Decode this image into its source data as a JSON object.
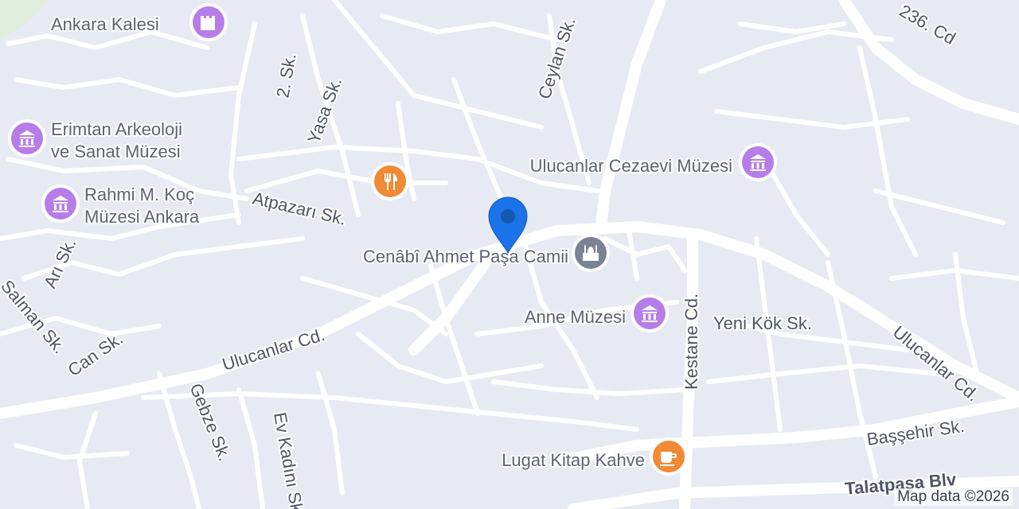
{
  "pois": [
    {
      "label": "Ankara Kalesi",
      "icon": "castle-icon"
    },
    {
      "label_lines": [
        "Erimtan Arkeoloji",
        "ve Sanat Müzesi"
      ],
      "icon": "museum-icon"
    },
    {
      "label_lines": [
        "Rahmi M. Koç",
        "Müzesi Ankara"
      ],
      "icon": "museum-icon"
    },
    {
      "label": "Ulucanlar Cezaevi Müzesi",
      "icon": "museum-icon"
    },
    {
      "label": "Cenâbî Ahmet Paşa Camii",
      "icon": "mosque-icon"
    },
    {
      "label": "Anne Müzesi",
      "icon": "museum-icon"
    },
    {
      "label": "Lugat Kitap Kahve",
      "icon": "cafe-icon"
    },
    {
      "label": "",
      "icon": "restaurant-icon"
    }
  ],
  "streets": [
    "Yasa Sk.",
    "2. Sk.",
    "Ceylan Sk.",
    "236. Cd",
    "Atpazarı Sk.",
    "Arı Sk.",
    "Salman Sk.",
    "Can Sk.",
    "Ulucanlar Cd.",
    "Gebze Sk.",
    "Ev Kadını Sk.",
    "Kestane Cd.",
    "Yeni Kök Sk.",
    "Ulucanlar Cd.",
    "Başşehir Sk.",
    "Talatpaşa Blv"
  ],
  "colors": {
    "museum": "#b67de8",
    "food": "#f08a35",
    "location": "#1a73e8",
    "background": "#e8eaf3",
    "road": "#ffffff"
  },
  "attribution": "Map data ©2026"
}
